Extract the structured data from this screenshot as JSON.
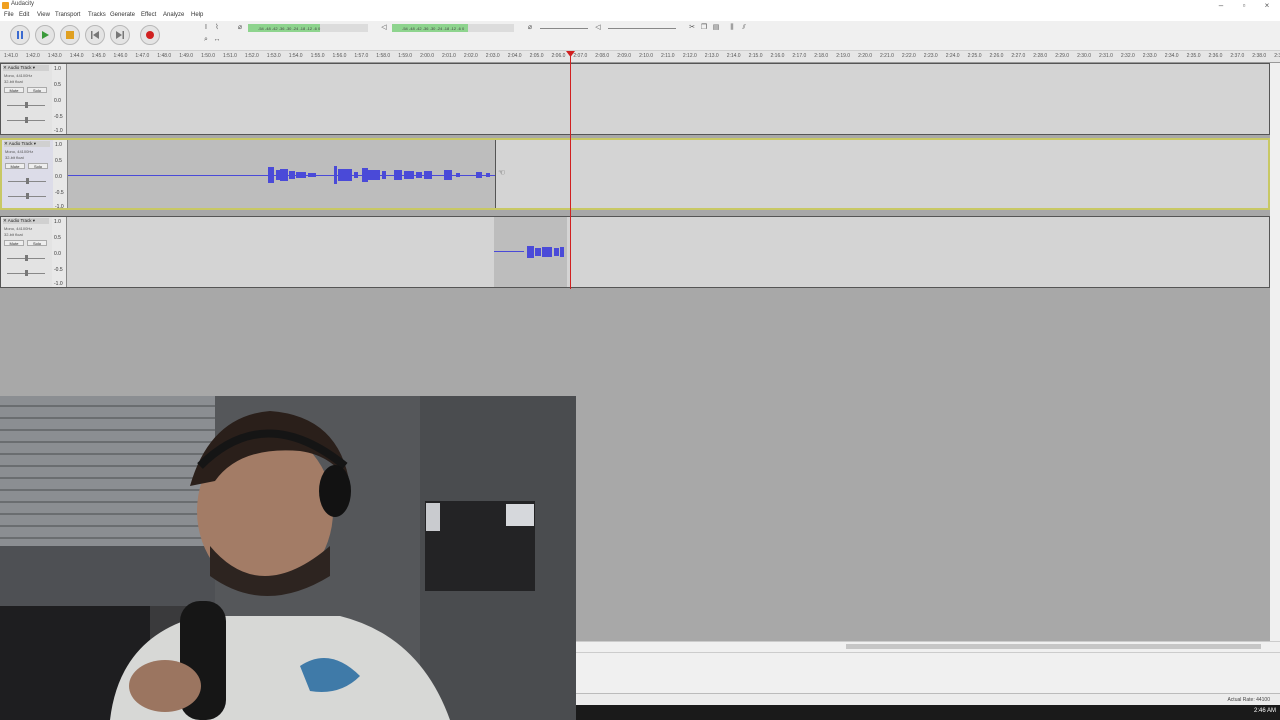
{
  "window": {
    "title": "Audacity"
  },
  "menu": [
    "File",
    "Edit",
    "View",
    "Transport",
    "Tracks",
    "Generate",
    "Effect",
    "Analyze",
    "Help"
  ],
  "transport": [
    "pause",
    "play",
    "stop",
    "skip-start",
    "skip-end",
    "record"
  ],
  "meters": {
    "record_ticks": [
      "-54",
      "-48",
      "-42",
      "-36",
      "-30",
      "-24",
      "-18",
      "-12",
      "-6",
      "0"
    ],
    "playback_ticks": [
      "-54",
      "-48",
      "-42",
      "-36",
      "-30",
      "-24",
      "-18",
      "-12",
      "-6",
      "0"
    ]
  },
  "ruler": {
    "ticks": [
      "1:41.0",
      "1:42.0",
      "1:43.0",
      "1:44.0",
      "1:45.0",
      "1:46.0",
      "1:47.0",
      "1:48.0",
      "1:49.0",
      "1:50.0",
      "1:51.0",
      "1:52.0",
      "1:53.0",
      "1:54.0",
      "1:55.0",
      "1:56.0",
      "1:57.0",
      "1:58.0",
      "1:59.0",
      "2:00.0",
      "2:01.0",
      "2:02.0",
      "2:03.0",
      "2:04.0",
      "2:05.0",
      "2:06.0",
      "2:07.0",
      "2:08.0",
      "2:09.0",
      "2:10.0",
      "2:11.0",
      "2:12.0",
      "2:13.0",
      "2:14.0",
      "2:15.0",
      "2:16.0",
      "2:17.0",
      "2:18.0",
      "2:19.0",
      "2:20.0",
      "2:21.0",
      "2:22.0",
      "2:23.0",
      "2:24.0",
      "2:25.0",
      "2:26.0",
      "2:27.0",
      "2:28.0",
      "2:29.0",
      "2:30.0",
      "2:31.0",
      "2:32.0",
      "2:33.0",
      "2:34.0",
      "2:35.0",
      "2:36.0",
      "2:37.0",
      "2:38.0",
      "2:39.0"
    ]
  },
  "tracks": [
    {
      "name": "Audio Track",
      "line1": "Mono, 44100Hz",
      "line2": "32-bit float",
      "mute": "Mute",
      "solo": "Solo",
      "scale": [
        "1.0",
        "0.5",
        "0.0",
        "-0.5",
        "-1.0"
      ]
    },
    {
      "name": "Audio Track",
      "line1": "Mono, 44100Hz",
      "line2": "32-bit float",
      "mute": "Mute",
      "solo": "Solo",
      "scale": [
        "1.0",
        "0.5",
        "0.0",
        "-0.5",
        "-1.0"
      ]
    },
    {
      "name": "Audio Track",
      "line1": "Mono, 44100Hz",
      "line2": "32-bit float",
      "mute": "Mute",
      "solo": "Solo",
      "scale": [
        "1.0",
        "0.5",
        "0.0",
        "-0.5",
        "-1.0"
      ]
    }
  ],
  "status": {
    "actual_rate": "Actual Rate: 44100"
  },
  "taskbar": {
    "clock": "2:46 AM"
  },
  "colors": {
    "waveform": "#4a4ad8",
    "playhead": "#d02020",
    "meter": "#8ed48e"
  }
}
